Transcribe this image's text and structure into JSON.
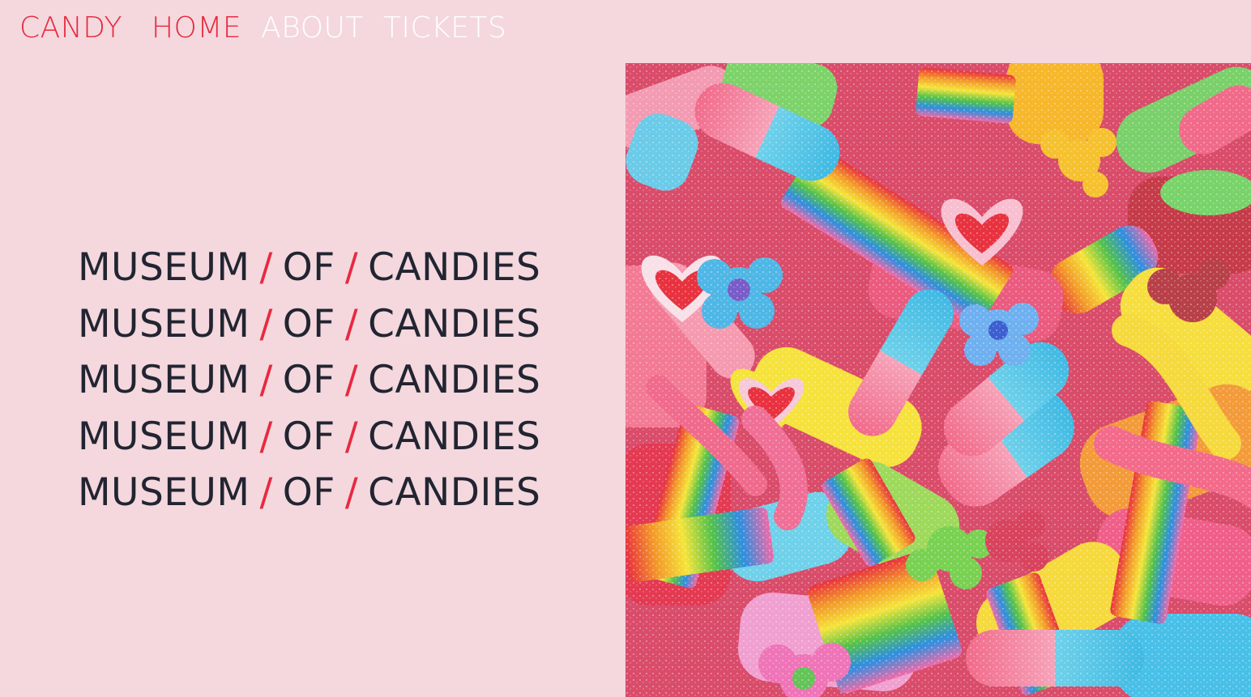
{
  "nav": {
    "brand": "CANDY",
    "links": [
      {
        "label": "HOME",
        "active": true
      },
      {
        "label": "ABOUT",
        "active": false
      },
      {
        "label": "TICKETS",
        "active": false
      }
    ]
  },
  "headline": {
    "word1": "MUSEUM",
    "separator": "/",
    "word2": "OF",
    "word3": "CANDIES",
    "repeat": 5
  },
  "hero_image": {
    "subject": "pile of colorful sour gummy candies"
  },
  "colors": {
    "background": "#f4d8de",
    "accent": "#e8293f",
    "text": "#222531",
    "nav_inactive": "#ffffff"
  }
}
